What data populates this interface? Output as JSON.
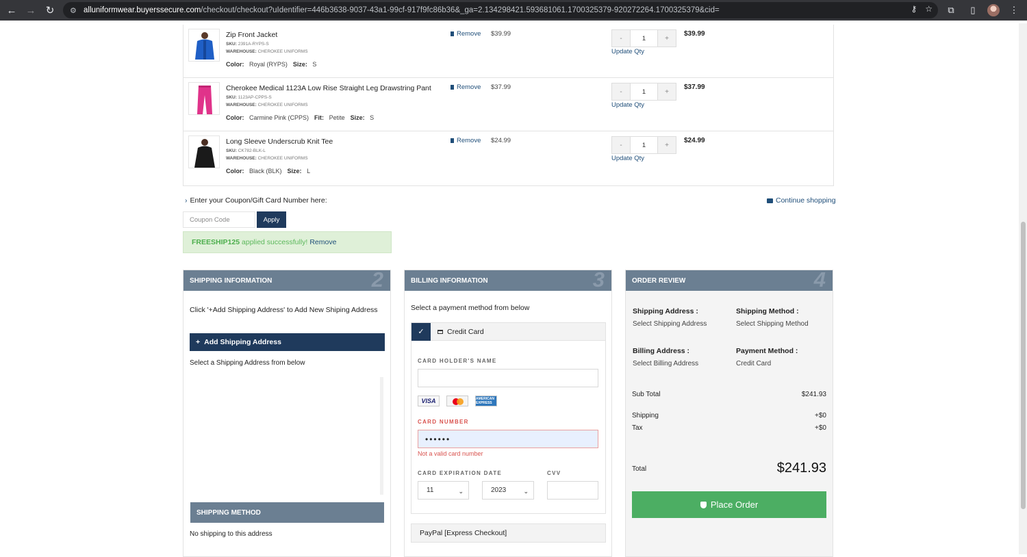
{
  "browser": {
    "url_host": "alluniformwear.buyerssecure.com",
    "url_path": "/checkout/checkout?uIdentifier=446b3638-9037-43a1-99cf-917f9fc86b36&_ga=2.134298421.593681061.1700325379-920272264.1700325379&cid=",
    "back_icon": "←",
    "forward_icon": "→",
    "reload_icon": "↻",
    "site_icon": "⚙",
    "key_icon": "⚷",
    "star_icon": "☆",
    "ext_icon": "⧉",
    "sidebar_icon": "▯",
    "menu_icon": "⋮"
  },
  "cart": {
    "items": [
      {
        "name": "Zip Front Jacket",
        "sku_label": "SKU:",
        "sku": "2391A-RYPS-S",
        "warehouse_label": "WAREHOUSE:",
        "warehouse": "CHEROKEE UNIFORMS",
        "attrs": [
          {
            "label": "Color:",
            "value": "Royal (RYPS)"
          },
          {
            "label": "Size:",
            "value": "S"
          }
        ],
        "remove": "Remove",
        "price": "$39.99",
        "qty": "1",
        "minus": "-",
        "plus": "+",
        "update": "Update Qty",
        "total": "$39.99",
        "thumb_color": "#1f5fc6"
      },
      {
        "name": "Cherokee Medical 1123A Low Rise Straight Leg Drawstring Pant",
        "sku_label": "SKU:",
        "sku": "1123AP-CPPS-S",
        "warehouse_label": "WAREHOUSE:",
        "warehouse": "CHEROKEE UNIFORMS",
        "attrs": [
          {
            "label": "Color:",
            "value": "Carmine Pink (CPPS)"
          },
          {
            "label": "Fit:",
            "value": "Petite"
          },
          {
            "label": "Size:",
            "value": "S"
          }
        ],
        "remove": "Remove",
        "price": "$37.99",
        "qty": "1",
        "minus": "-",
        "plus": "+",
        "update": "Update Qty",
        "total": "$37.99",
        "thumb_color": "#e0338a"
      },
      {
        "name": "Long Sleeve Underscrub Knit Tee",
        "sku_label": "SKU:",
        "sku": "CK782-BLK-L",
        "warehouse_label": "WAREHOUSE:",
        "warehouse": "CHEROKEE UNIFORMS",
        "attrs": [
          {
            "label": "Color:",
            "value": "Black (BLK)"
          },
          {
            "label": "Size:",
            "value": "L"
          }
        ],
        "remove": "Remove",
        "price": "$24.99",
        "qty": "1",
        "minus": "-",
        "plus": "+",
        "update": "Update Qty",
        "total": "$24.99",
        "thumb_color": "#1a1a1a"
      }
    ]
  },
  "coupon": {
    "toggle_label": "Enter your Coupon/Gift Card Number here:",
    "chevron_icon": "›",
    "continue_label": "Continue shopping",
    "placeholder": "Coupon Code",
    "apply_label": "Apply",
    "applied_code": "FREESHIP125",
    "applied_msg": "applied successfully!",
    "remove_label": "Remove"
  },
  "shipping": {
    "title": "SHIPPING INFORMATION",
    "step": "2",
    "note": "Click '+Add Shipping Address' to Add New Shiping Address",
    "add_label": "Add Shipping Address",
    "plus_icon": "+",
    "select_label": "Select a Shipping Address from below",
    "method_title": "SHIPPING METHOD",
    "no_shipping": "No shipping to this address"
  },
  "billing": {
    "title": "BILLING INFORMATION",
    "step": "3",
    "select_label": "Select a payment method from below",
    "check_icon": "✓",
    "credit_card_label": "Credit Card",
    "holder_label": "CARD HOLDER'S NAME",
    "card_visa": "VISA",
    "card_amex": "AMERICAN EXPRESS",
    "number_label": "CARD NUMBER",
    "number_value": "••••••",
    "number_error": "Not a valid card number",
    "expiry_label": "CARD EXPIRATION DATE",
    "cvv_label": "CVV",
    "month": "11",
    "year": "2023",
    "caret": "⌄",
    "paypal_label": "PayPal [Express Checkout]"
  },
  "review": {
    "title": "ORDER REVIEW",
    "step": "4",
    "ship_addr_label": "Shipping Address :",
    "ship_addr_value": "Select Shipping Address",
    "ship_method_label": "Shipping Method :",
    "ship_method_value": "Select Shipping Method",
    "bill_addr_label": "Billing Address :",
    "bill_addr_value": "Select Billing Address",
    "pay_method_label": "Payment Method :",
    "pay_method_value": "Credit Card",
    "subtotal_label": "Sub Total",
    "subtotal_value": "$241.93",
    "shipping_label": "Shipping",
    "shipping_value": "+$0",
    "tax_label": "Tax",
    "tax_value": "+$0",
    "total_label": "Total",
    "total_value": "$241.93",
    "place_order": "Place Order"
  },
  "colors": {
    "navy": "#1f3a5c",
    "panel_header": "#6b7f92",
    "success_bg": "#dff0d8",
    "place_order": "#4cae63",
    "error": "#d9534f"
  }
}
